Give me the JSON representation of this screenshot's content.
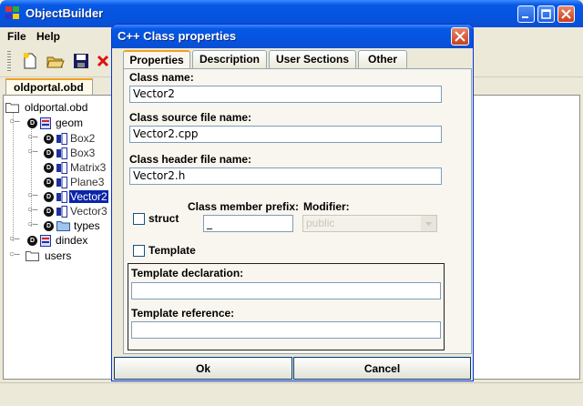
{
  "app": {
    "title": "ObjectBuilder",
    "menu": [
      "File",
      "Help"
    ],
    "toolbar_icons": [
      "new-file-icon",
      "open-folder-icon",
      "save-disk-icon",
      "delete-x-icon"
    ],
    "doc_tab": "oldportal.obd"
  },
  "tree": {
    "root": "oldportal.obd",
    "geom": "geom",
    "geom_children": [
      "Box2",
      "Box3",
      "Matrix3",
      "Plane3",
      "Vector2",
      "Vector3",
      "types"
    ],
    "selected": "Vector2",
    "dindex": "dindex",
    "users": "users",
    "badge": "D"
  },
  "dialog": {
    "title": "C++ Class properties",
    "tabs": [
      "Properties",
      "Description",
      "User Sections",
      "Other"
    ],
    "active_tab": "Properties",
    "class_name_label": "Class name:",
    "class_name_value": "Vector2",
    "source_label": "Class source file name:",
    "source_value": "Vector2.cpp",
    "header_label": "Class header file name:",
    "header_value": "Vector2.h",
    "struct_label": "struct",
    "struct_checked": false,
    "prefix_label": "Class member prefix:",
    "prefix_value": "_",
    "modifier_label": "Modifier:",
    "modifier_value": "public",
    "template_label": "Template",
    "template_checked": false,
    "template_decl_label": "Template declaration:",
    "template_decl_value": "",
    "template_ref_label": "Template reference:",
    "template_ref_value": "",
    "ok_label": "Ok",
    "cancel_label": "Cancel"
  },
  "colors": {
    "xp_blue": "#0454e0",
    "selection": "#0a24a8",
    "tab_accent": "#f0a020"
  }
}
